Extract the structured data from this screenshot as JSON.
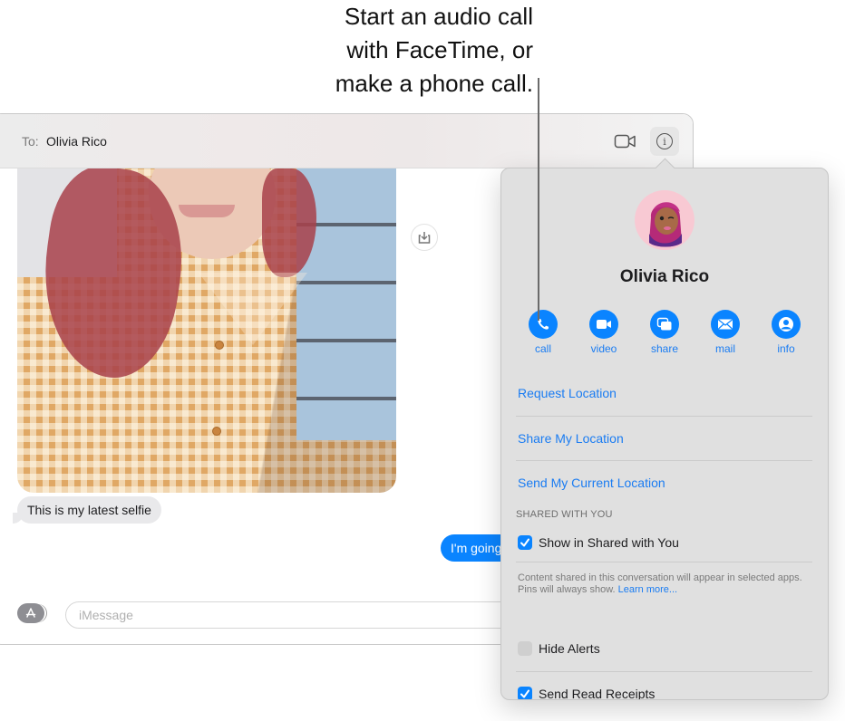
{
  "callout": {
    "lines": [
      "Start an audio call",
      "with FaceTime, or",
      "make a phone call."
    ]
  },
  "header": {
    "to_label": "To:",
    "recipient": "Olivia Rico",
    "video_icon": "video-camera-icon",
    "info_icon": "info-icon",
    "info_glyph": "i"
  },
  "conversation": {
    "photo_alt": "selfie photo",
    "save_icon": "save-download-icon",
    "incoming_message": "This is my latest selfie",
    "outgoing_message": "I'm going"
  },
  "composer": {
    "apps_icon": "app-store-icon",
    "placeholder": "iMessage",
    "value": ""
  },
  "details": {
    "contact_name": "Olivia Rico",
    "actions": [
      {
        "label": "call",
        "icon": "phone-icon"
      },
      {
        "label": "video",
        "icon": "video-icon"
      },
      {
        "label": "share",
        "icon": "share-screen-icon"
      },
      {
        "label": "mail",
        "icon": "mail-icon"
      },
      {
        "label": "info",
        "icon": "person-icon"
      }
    ],
    "location_links": [
      "Request Location",
      "Share My Location",
      "Send My Current Location"
    ],
    "shared_with_you_header": "SHARED WITH YOU",
    "show_in_shared": {
      "label": "Show in Shared with You",
      "checked": true
    },
    "note_text": "Content shared in this conversation will appear in selected apps. Pins will always show.",
    "learn_more": "Learn more...",
    "hide_alerts": {
      "label": "Hide Alerts",
      "checked": false
    },
    "send_read_receipts": {
      "label": "Send Read Receipts",
      "checked": true
    }
  },
  "colors": {
    "accent": "#0a84ff",
    "link": "#1a7cf2",
    "popover_bg": "#e0e0e0"
  }
}
